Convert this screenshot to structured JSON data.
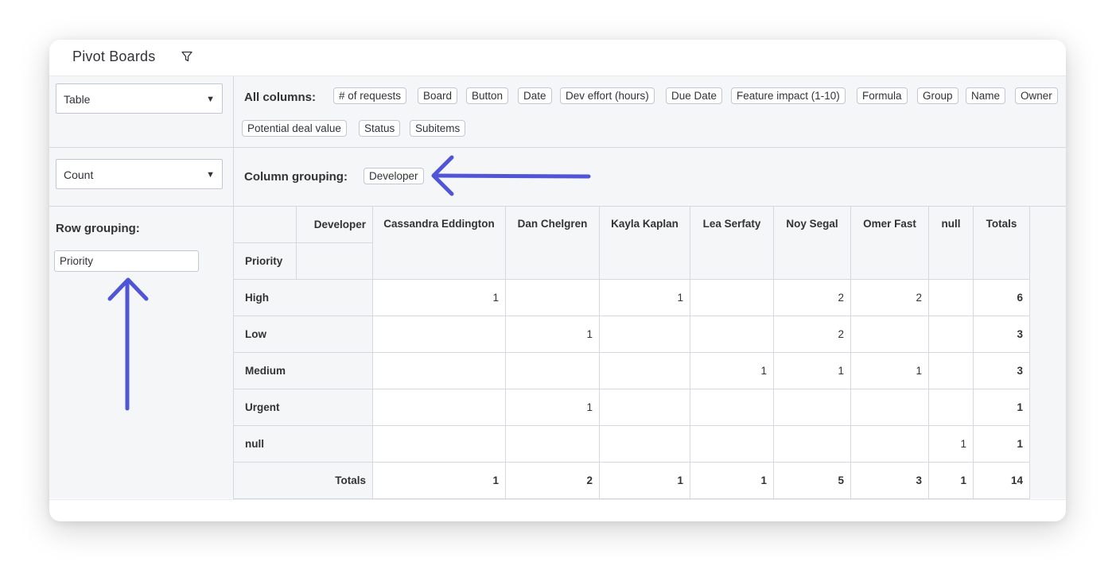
{
  "header": {
    "title": "Pivot Boards",
    "filter_icon": "filter-icon"
  },
  "renderer_select": {
    "value": "Table"
  },
  "aggregator_select": {
    "value": "Count"
  },
  "all_columns": {
    "label": "All columns:",
    "items": [
      "# of requests",
      "Board",
      "Button",
      "Date",
      "Dev effort (hours)",
      "Due Date",
      "Feature impact (1-10)",
      "Formula",
      "Group",
      "Name",
      "Owner",
      "Potential deal value",
      "Status",
      "Subitems"
    ]
  },
  "column_grouping": {
    "label": "Column grouping:",
    "items": [
      "Developer"
    ]
  },
  "row_grouping": {
    "label": "Row grouping:",
    "items": [
      "Priority"
    ]
  },
  "pivot": {
    "col_attr": "Developer",
    "row_attr": "Priority",
    "columns": [
      "Cassandra Eddington",
      "Dan Chelgren",
      "Kayla Kaplan",
      "Lea Serfaty",
      "Noy Segal",
      "Omer Fast",
      "null"
    ],
    "totals_label": "Totals",
    "rows": [
      {
        "label": "High",
        "cells": [
          "1",
          "",
          "1",
          "",
          "2",
          "2",
          ""
        ],
        "total": "6"
      },
      {
        "label": "Low",
        "cells": [
          "",
          "1",
          "",
          "",
          "2",
          "",
          ""
        ],
        "total": "3"
      },
      {
        "label": "Medium",
        "cells": [
          "",
          "",
          "",
          "1",
          "1",
          "1",
          ""
        ],
        "total": "3"
      },
      {
        "label": "Urgent",
        "cells": [
          "",
          "1",
          "",
          "",
          "",
          "",
          ""
        ],
        "total": "1"
      },
      {
        "label": "null",
        "cells": [
          "",
          "",
          "",
          "",
          "",
          "",
          "1"
        ],
        "total": "1"
      }
    ],
    "column_totals": [
      "1",
      "2",
      "1",
      "1",
      "5",
      "3",
      "1"
    ],
    "grand_total": "14"
  },
  "colors": {
    "annotation_arrow": "#4f55d6",
    "panel_bg": "#f5f6f8",
    "border": "#d5d8df"
  }
}
